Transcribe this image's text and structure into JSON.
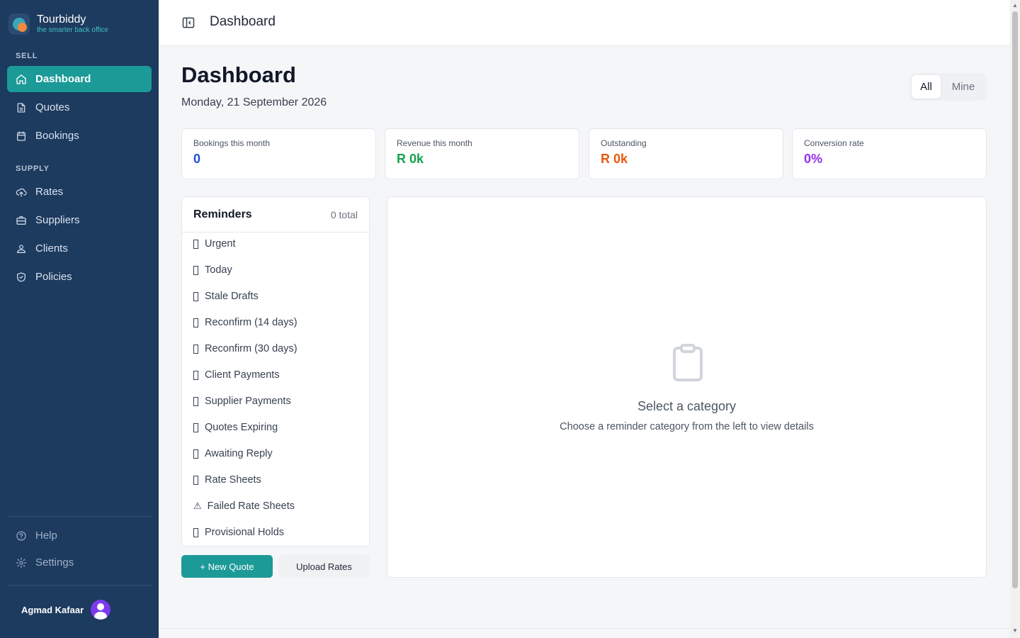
{
  "brand": {
    "name": "Tourbiddy",
    "tagline": "the smarter back office"
  },
  "sidebar": {
    "sections": [
      {
        "label": "SELL"
      },
      {
        "label": "SUPPLY"
      }
    ],
    "items": [
      {
        "label": "Dashboard",
        "icon": "home-icon",
        "active": true
      },
      {
        "label": "Quotes",
        "icon": "document-icon"
      },
      {
        "label": "Bookings",
        "icon": "calendar-icon"
      },
      {
        "label": "Rates",
        "icon": "upload-cloud-icon"
      },
      {
        "label": "Suppliers",
        "icon": "briefcase-icon"
      },
      {
        "label": "Clients",
        "icon": "users-icon"
      },
      {
        "label": "Policies",
        "icon": "shield-icon"
      }
    ],
    "footer_items": [
      {
        "label": "Help",
        "icon": "help-circle-icon"
      },
      {
        "label": "Settings",
        "icon": "gear-icon"
      }
    ],
    "user": {
      "name": "Agmad Kafaar"
    }
  },
  "header": {
    "title": "Dashboard"
  },
  "main": {
    "title": "Dashboard",
    "date": "Monday, 21 September 2026",
    "filter": {
      "options": [
        "All",
        "Mine"
      ],
      "selected": "All"
    },
    "stats": [
      {
        "label": "Bookings this month",
        "value": "0",
        "color": "#1d4ed8"
      },
      {
        "label": "Revenue this month",
        "value": "R 0k",
        "color": "#16a34a"
      },
      {
        "label": "Outstanding",
        "value": "R 0k",
        "color": "#ea580c"
      },
      {
        "label": "Conversion rate",
        "value": "0%",
        "color": "#9333ea"
      }
    ],
    "reminders": {
      "title": "Reminders",
      "count": "0 total",
      "items": [
        {
          "label": "Urgent",
          "glyph": ""
        },
        {
          "label": "Today",
          "glyph": ""
        },
        {
          "label": "Stale Drafts",
          "glyph": ""
        },
        {
          "label": "Reconfirm (14 days)",
          "glyph": ""
        },
        {
          "label": "Reconfirm (30 days)",
          "glyph": ""
        },
        {
          "label": "Client Payments",
          "glyph": ""
        },
        {
          "label": "Supplier Payments",
          "glyph": ""
        },
        {
          "label": "Quotes Expiring",
          "glyph": ""
        },
        {
          "label": "Awaiting Reply",
          "glyph": ""
        },
        {
          "label": "Rate Sheets",
          "glyph": ""
        },
        {
          "label": "Failed Rate Sheets",
          "glyph": "⚠"
        },
        {
          "label": "Provisional Holds",
          "glyph": ""
        }
      ]
    },
    "actions": {
      "new_quote": "+ New Quote",
      "upload_rates": "Upload Rates"
    },
    "empty_state": {
      "icon": "clipboard-icon",
      "title": "Select a category",
      "subtitle": "Choose a reminder category from the left to view details"
    }
  },
  "colors": {
    "sidebar_bg": "#1d3a5f",
    "accent": "#1c9a98"
  }
}
